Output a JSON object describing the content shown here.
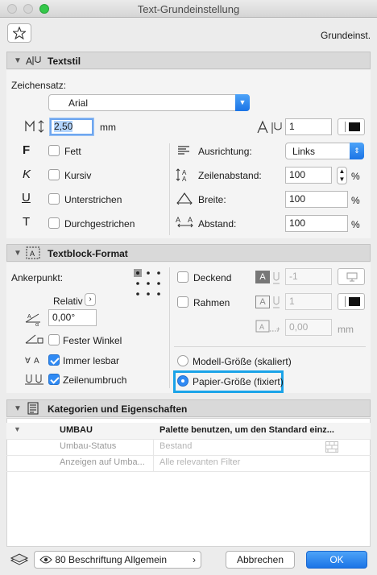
{
  "window": {
    "title": "Text-Grundeinstellung"
  },
  "header": {
    "favorite_label": "",
    "preset_name": "Grundeinst."
  },
  "sections": {
    "textstil": "Textstil",
    "textblock": "Textblock-Format",
    "kategorien": "Kategorien und Eigenschaften"
  },
  "textstil": {
    "charset_label": "Zeichensatz:",
    "font": "Arial",
    "size_value": "2,50",
    "size_unit": "mm",
    "pen_value": "1",
    "fett": "Fett",
    "kursiv": "Kursiv",
    "unterstrichen": "Unterstrichen",
    "durchgestrichen": "Durchgestrichen",
    "ausrichtung_label": "Ausrichtung:",
    "ausrichtung_value": "Links",
    "zeilenabstand_label": "Zeilenabstand:",
    "zeilenabstand_value": "100",
    "breite_label": "Breite:",
    "breite_value": "100",
    "abstand_label": "Abstand:",
    "abstand_value": "100",
    "pct": "%"
  },
  "textblock": {
    "ankerpunkt_label": "Ankerpunkt:",
    "relativ_label": "Relativ",
    "angle_value": "0,00°",
    "fester_winkel": "Fester Winkel",
    "immer_lesbar": "Immer lesbar",
    "zeilenumbruch": "Zeilenumbruch",
    "deckend": "Deckend",
    "deckend_value": "-1",
    "rahmen": "Rahmen",
    "rahmen_value": "1",
    "offset_value": "0,00",
    "offset_unit": "mm",
    "modell_groesse": "Modell-Größe (skaliert)",
    "papier_groesse": "Papier-Größe (fixiert)"
  },
  "kategorien": {
    "rows": [
      {
        "name": "UMBAU",
        "value": "Palette benutzen, um den Standard einz..."
      },
      {
        "name": "Umbau-Status",
        "value": "Bestand"
      },
      {
        "name": "Anzeigen auf Umba...",
        "value": "Alle relevanten Filter"
      }
    ]
  },
  "footer": {
    "layer_label": "80 Beschriftung Allgemein",
    "cancel_label": "Abbrechen",
    "ok_label": "OK"
  },
  "colors": {
    "accent": "#1b74e6",
    "focus_ring": "#1aa3e8"
  }
}
